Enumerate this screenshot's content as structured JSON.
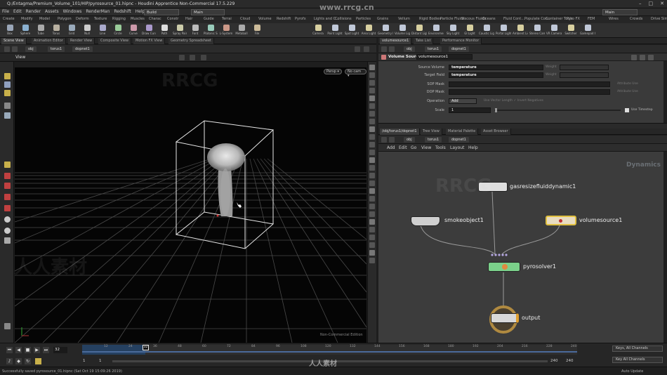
{
  "window": {
    "title": "Q:/Entagma/Premium_Volume_101/HIP/pyrosource_01.hipnc - Houdini Apprentice Non-Commercial 17.5.229",
    "controls": [
      "–",
      "□",
      "✕"
    ]
  },
  "menubar": {
    "items": [
      "File",
      "Edit",
      "Render",
      "Assets",
      "Windows",
      "RenderMan",
      "Redshift",
      "Help"
    ],
    "desktop_dropdown": "Build",
    "context_dropdown": "Main",
    "right_dropdown": "Main"
  },
  "shelf_tabs": {
    "left": [
      "Create",
      "Modify",
      "Model",
      "Polygon",
      "Deform",
      "Texture",
      "Rigging",
      "Muscles",
      "Charac",
      "Constr",
      "Hair",
      "Guide",
      "Terrai",
      "Cloud",
      "Volume",
      "Redshift",
      "Pyrofx"
    ],
    "right": [
      "Lights and C...",
      "Collisions",
      "Particles",
      "Grains",
      "Vellum",
      "Rigid Bodies",
      "Particle Fluids",
      "Viscous Fluids",
      "Oceans",
      "Fluid Cont...",
      "Populate Con...",
      "Container Tools",
      "Pyro FX",
      "FEM",
      "Wires",
      "Crowds",
      "Drive Simula..."
    ]
  },
  "shelf_tools": {
    "left": [
      "Box",
      "Sphere",
      "Tube",
      "Torus",
      "Grid",
      "Null",
      "Line",
      "Circle",
      "Curve",
      "Draw Curve",
      "Path",
      "Spray Paint",
      "Font",
      "Platonic Solids",
      "L-System",
      "Metaball",
      "File"
    ],
    "right": [
      "Camera",
      "Point Light",
      "Spot Light",
      "Area Light",
      "Geometry Light",
      "Volume Light",
      "Distant Light",
      "Environment Light",
      "Sky Light",
      "GI Light",
      "Caustic Light",
      "Portal Light",
      "Ambient Light",
      "Stereo Camera",
      "VR Camera",
      "Switcher",
      "Gamepad Camera"
    ]
  },
  "left_pane": {
    "tabs": [
      "Scene View",
      "Animation Editor",
      "Render View",
      "Composite View",
      "Motion FX View",
      "Geometry Spreadsheet"
    ],
    "path": [
      "obj",
      "torus1",
      "dopnet1"
    ],
    "view_label": "View",
    "persp_button": "Persp ▾",
    "cam_button": "No cam ▾",
    "non_commercial": "Non-Commercial Edition"
  },
  "params": {
    "tabs": [
      "volumesource1",
      "Take List",
      "Performance Monitor"
    ],
    "path": [
      "obj",
      "torus1",
      "dopnet1"
    ],
    "node_type": "Volume Source",
    "node_name": "volumesource1",
    "rows": [
      {
        "label": "Source Volume",
        "value": "temperature",
        "extra": "Weight"
      },
      {
        "label": "Target Field",
        "value": "temperature",
        "extra": "Weight"
      },
      {
        "label": "SOP Mask",
        "value": "",
        "extra": "Attribute  Use"
      },
      {
        "label": "DOP Mask",
        "value": "",
        "extra": "Attribute  Use"
      },
      {
        "label": "Operation",
        "value": "Add",
        "extra": "Use Vector Length   ✓ Invert Negatives"
      },
      {
        "label": "Scale",
        "value": "1",
        "extra": "Use Timestep"
      }
    ]
  },
  "network": {
    "tabs": [
      "/obj/torus1/dopnet1",
      "Tree View",
      "Material Palette",
      "Asset Browser"
    ],
    "path": [
      "obj",
      "torus1",
      "dopnet1"
    ],
    "menu": [
      "Add",
      "Edit",
      "Go",
      "View",
      "Tools",
      "Layout",
      "Help"
    ],
    "context_label": "Dynamics",
    "nodes": [
      "gasresizefluiddynamic1",
      "smokeobject1",
      "volumesource1",
      "pyrosolver1",
      "output"
    ]
  },
  "timeline": {
    "current_frame": "32",
    "start_frame": "1",
    "start_frame2": "1",
    "end_frame": "240",
    "end_frame2": "240",
    "ticks": [
      "12",
      "24",
      "36",
      "48",
      "60",
      "72",
      "84",
      "96",
      "108",
      "120",
      "132",
      "144",
      "156",
      "168",
      "180",
      "192",
      "204",
      "216",
      "228",
      "240"
    ],
    "keys_dropdown": "Keys, All Channels",
    "keyall_dropdown": "Key All Channels",
    "auto_update": "Auto Update",
    "status": "Successfully saved pyrosource_01.hipnc (Sat Oct 19 15:09:26 2019)"
  },
  "watermarks": [
    "www.rrcg.cn",
    "RRCG",
    "人人素材"
  ]
}
